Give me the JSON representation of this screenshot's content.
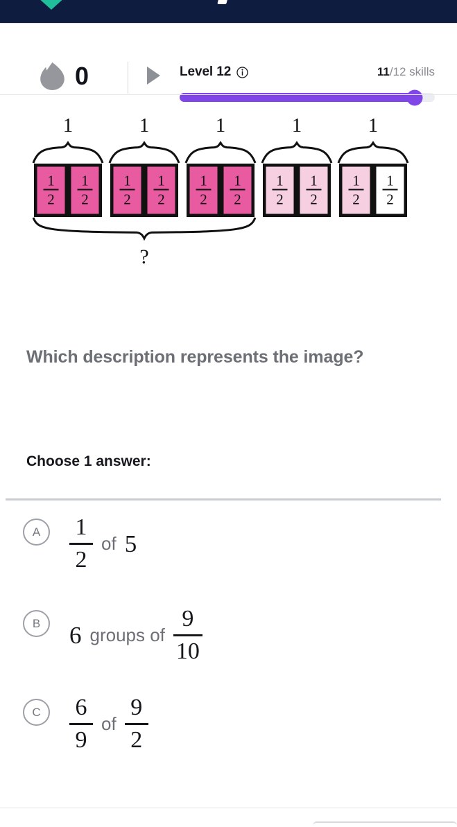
{
  "topbar": {
    "logo_icon": "khan-leaf-logo-icon",
    "glyph_icon": "wordmark-glyph-icon",
    "background_color": "#0d1c3f",
    "logo_color": "#1fbf9c"
  },
  "status": {
    "streak_icon": "flame-icon",
    "streak_count": "0",
    "play_icon": "play-triangle-icon",
    "level_label": "Level 12",
    "info_icon": "info-circle-icon",
    "skills_current": "11",
    "skills_total": "/12 skills",
    "progress_percent": 92,
    "progress_color": "#8046e8"
  },
  "diagram": {
    "group_label": "1",
    "cell_label_numerator": "1",
    "cell_label_denominator": "2",
    "bottom_brace_label": "?",
    "group_count": 5,
    "cells_per_group": 2,
    "dark_fill": "#e85ba0",
    "light_fill": "#f6cfe1",
    "empty_fill": "#ffffff",
    "groups": [
      {
        "cells": [
          "dark",
          "dark"
        ]
      },
      {
        "cells": [
          "dark",
          "dark"
        ]
      },
      {
        "cells": [
          "dark",
          "dark"
        ]
      },
      {
        "cells": [
          "light",
          "light"
        ]
      },
      {
        "cells": [
          "light",
          "empty"
        ]
      }
    ],
    "bottom_brace_spans_groups": [
      1,
      2,
      3
    ]
  },
  "question": {
    "prompt": "Which description represents the image?",
    "choose_label": "Choose 1 answer:"
  },
  "choices": [
    {
      "letter": "A",
      "type": "frac-of-num",
      "frac1_num": "1",
      "frac1_den": "2",
      "connector": "of",
      "value": "5"
    },
    {
      "letter": "B",
      "type": "num-groups-of-frac",
      "value": "6",
      "connector": "groups of",
      "frac1_num": "9",
      "frac1_den": "10"
    },
    {
      "letter": "C",
      "type": "frac-of-frac",
      "frac1_num": "6",
      "frac1_den": "9",
      "connector": "of",
      "frac2_num": "9",
      "frac2_den": "2"
    }
  ]
}
